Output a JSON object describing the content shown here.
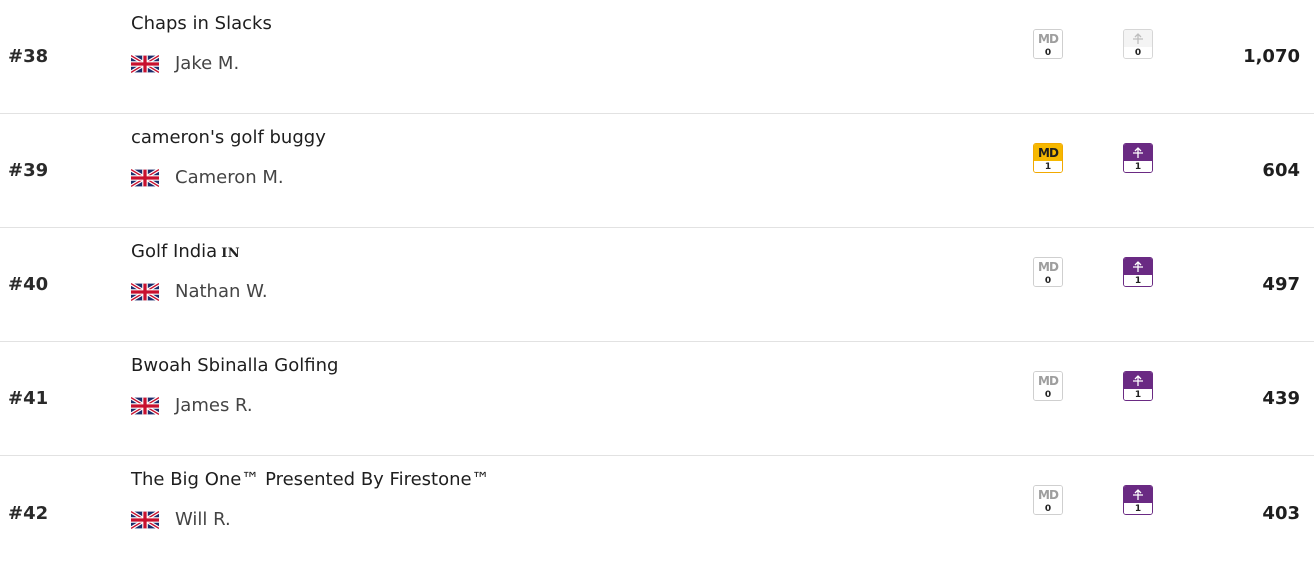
{
  "rows": [
    {
      "rank": "#38",
      "team": "Chaps in Slacks",
      "badge": "",
      "manager": "Jake M.",
      "md_count": "0",
      "md_label": "MD",
      "sub_count": "0",
      "points": "1,070"
    },
    {
      "rank": "#39",
      "team": "cameron's golf buggy",
      "badge": "",
      "manager": "Cameron M.",
      "md_count": "1",
      "md_label": "MD",
      "sub_count": "1",
      "points": "604"
    },
    {
      "rank": "#40",
      "team": "Golf India",
      "badge": "IN",
      "manager": "Nathan W.",
      "md_count": "0",
      "md_label": "MD",
      "sub_count": "1",
      "points": "497"
    },
    {
      "rank": "#41",
      "team": "Bwoah Sbinalla Golfing",
      "badge": "",
      "manager": "James R.",
      "md_count": "0",
      "md_label": "MD",
      "sub_count": "1",
      "points": "439"
    },
    {
      "rank": "#42",
      "team": "The Big One™ Presented By Firestone™",
      "badge": "",
      "manager": "Will R.",
      "md_count": "0",
      "md_label": "MD",
      "sub_count": "1",
      "points": "403"
    }
  ],
  "icons": {
    "flag": "uk-flag-icon",
    "sub": "substitution-icon"
  },
  "colors": {
    "md_active": "#f6b800",
    "sub_active": "#6a2a83",
    "inactive": "#9e9e9e"
  }
}
